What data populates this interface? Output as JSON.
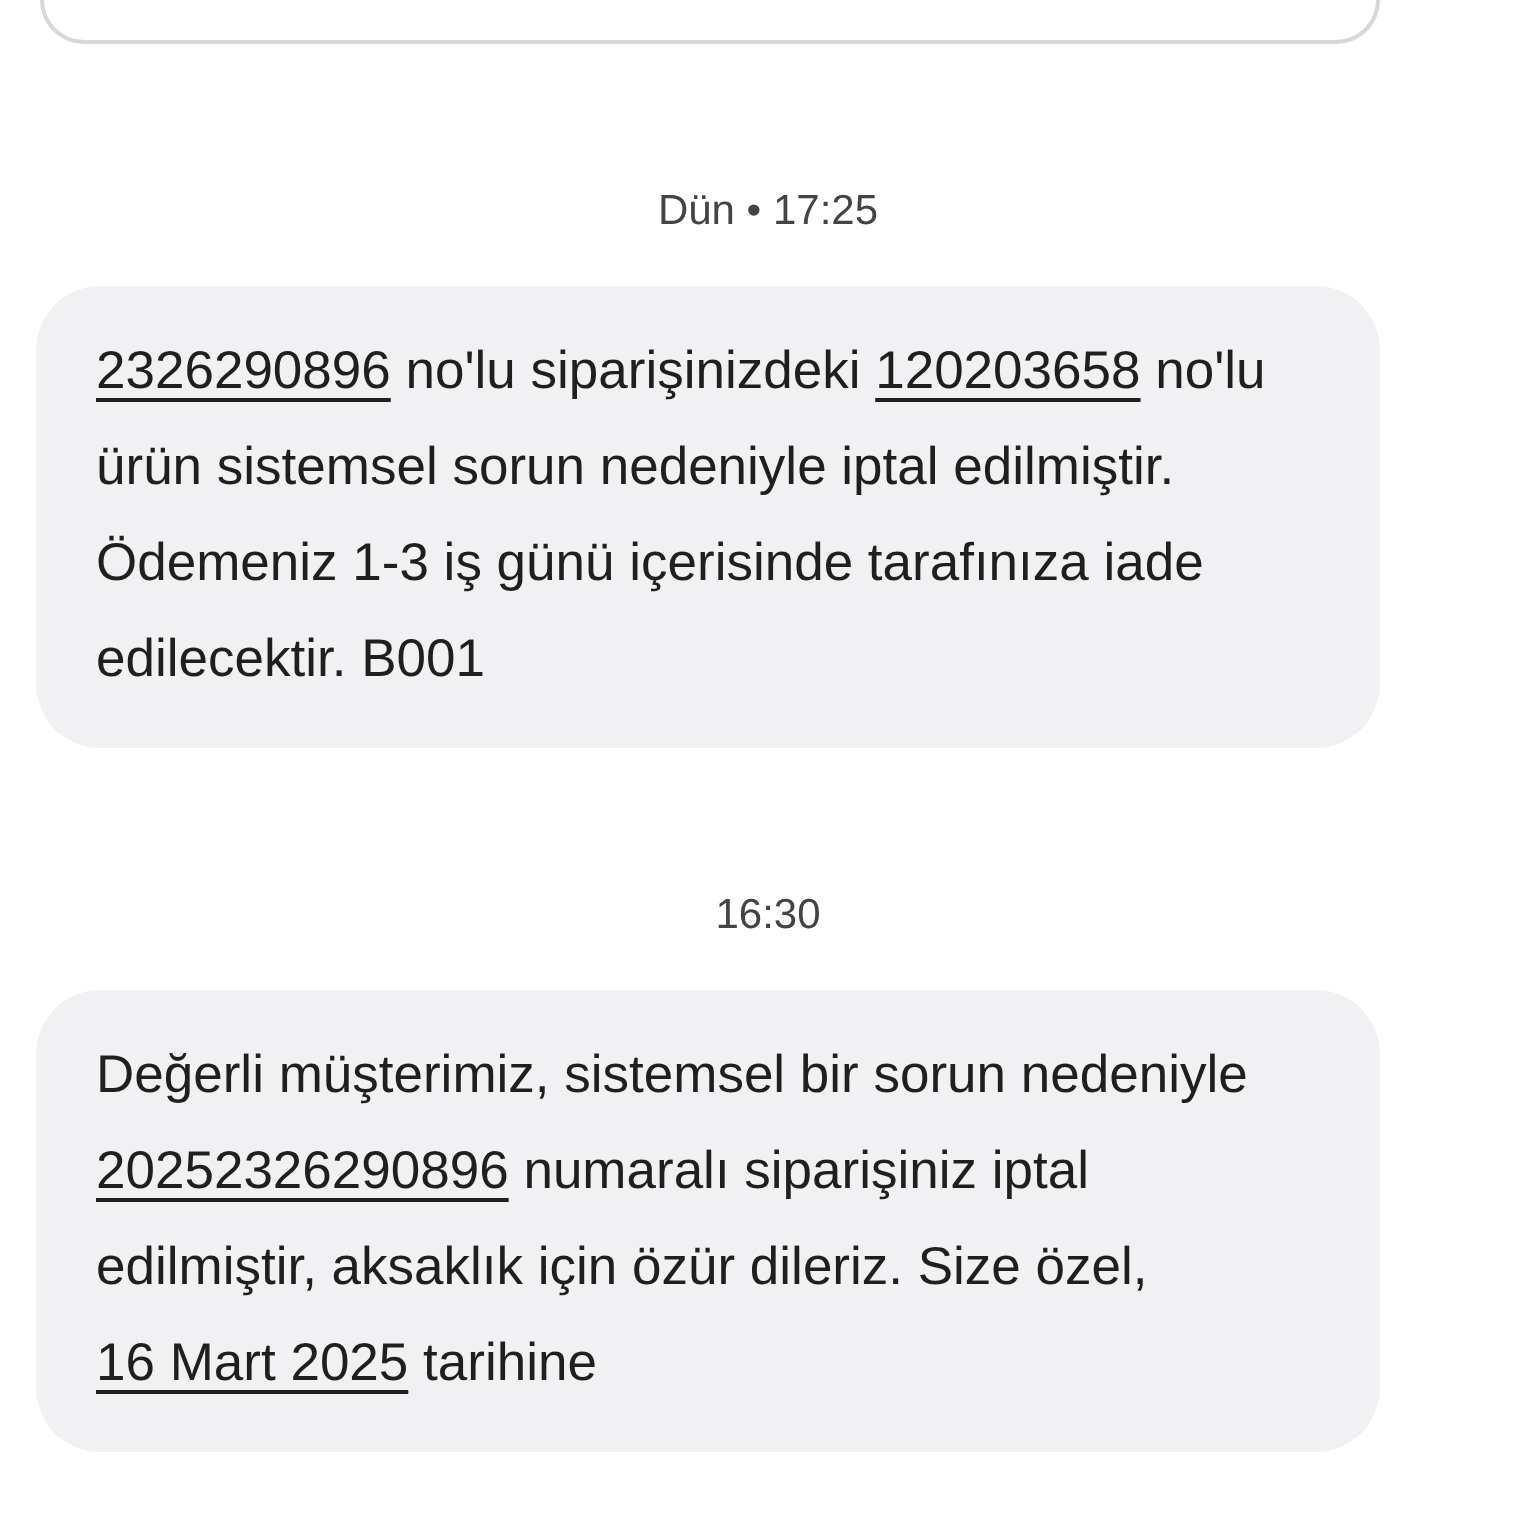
{
  "conversation": [
    {
      "kind": "bubble_edge"
    },
    {
      "kind": "timestamp",
      "text": "Dün • 17:25"
    },
    {
      "kind": "message",
      "segments": [
        {
          "kind": "link",
          "text": "2326290896"
        },
        {
          "kind": "plain",
          "text": " no'lu siparişinizdeki "
        },
        {
          "kind": "link",
          "text": "120203658"
        },
        {
          "kind": "plain",
          "text": " no'lu ürün sistemsel sorun nedeniyle iptal edilmiştir. Ödemeniz 1-3 iş günü içerisinde tarafınıza iade edilecektir. B001"
        }
      ]
    },
    {
      "kind": "timestamp",
      "text": "16:30"
    },
    {
      "kind": "message",
      "segments": [
        {
          "kind": "plain",
          "text": "Değerli müşterimiz, sistemsel bir sorun nedeniyle "
        },
        {
          "kind": "link",
          "text": "20252326290896"
        },
        {
          "kind": "plain",
          "text": " numaralı siparişiniz iptal edilmiştir, aksaklık için özür dileriz. Size özel, "
        },
        {
          "kind": "link",
          "text": "16 Mart 2025"
        },
        {
          "kind": "plain",
          "text": " tarihine"
        }
      ]
    }
  ]
}
